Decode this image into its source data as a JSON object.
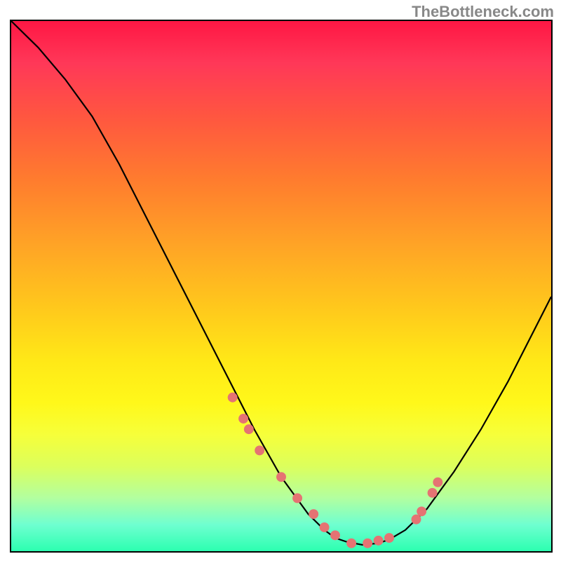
{
  "watermark": "TheBottleneck.com",
  "chart_data": {
    "type": "line",
    "title": "",
    "xlabel": "",
    "ylabel": "",
    "xlim": [
      0,
      100
    ],
    "ylim": [
      0,
      100
    ],
    "series": [
      {
        "name": "curve",
        "x": [
          0,
          5,
          10,
          15,
          20,
          25,
          30,
          35,
          40,
          45,
          50,
          55,
          58,
          60,
          62,
          65,
          68,
          70,
          73,
          77,
          82,
          87,
          92,
          97,
          100
        ],
        "values": [
          100,
          95,
          89,
          82,
          73,
          63,
          53,
          43,
          33,
          23,
          14,
          7,
          4,
          2.5,
          1.8,
          1.2,
          1.5,
          2.2,
          4,
          8,
          15,
          23,
          32,
          42,
          48
        ]
      }
    ],
    "points": {
      "name": "markers",
      "x": [
        41,
        43,
        44,
        46,
        50,
        53,
        56,
        58,
        60,
        63,
        66,
        68,
        70,
        75,
        76,
        78,
        79
      ],
      "values": [
        29,
        25,
        23,
        19,
        14,
        10,
        7,
        4.5,
        3,
        1.5,
        1.5,
        2,
        2.5,
        6,
        7.5,
        11,
        13
      ],
      "color": "#e57373",
      "radius": 7
    },
    "gradient_stops": [
      {
        "pct": 0,
        "color": "#ff1744"
      },
      {
        "pct": 8,
        "color": "#ff3858"
      },
      {
        "pct": 18,
        "color": "#ff5640"
      },
      {
        "pct": 30,
        "color": "#ff7c2e"
      },
      {
        "pct": 42,
        "color": "#ffa326"
      },
      {
        "pct": 54,
        "color": "#ffc81c"
      },
      {
        "pct": 64,
        "color": "#ffe817"
      },
      {
        "pct": 72,
        "color": "#fff81a"
      },
      {
        "pct": 78,
        "color": "#f6ff3a"
      },
      {
        "pct": 84,
        "color": "#dcff5c"
      },
      {
        "pct": 90,
        "color": "#b2ffa0"
      },
      {
        "pct": 95,
        "color": "#6fffd0"
      },
      {
        "pct": 100,
        "color": "#2cffb0"
      }
    ]
  }
}
